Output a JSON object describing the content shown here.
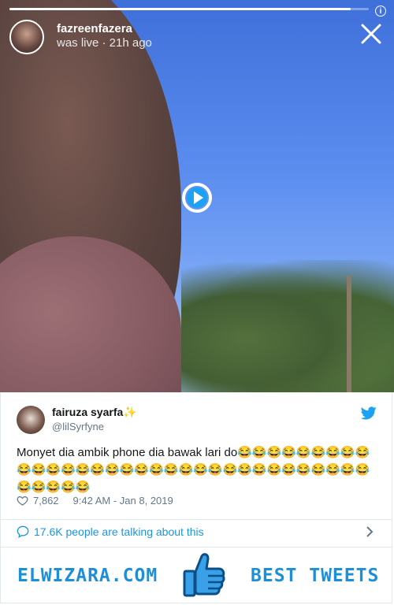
{
  "story": {
    "username": "fazreenfazera",
    "status": "was live · 21h ago",
    "progress": 0.95
  },
  "tweet": {
    "display_name": "fairuza syarfa✨",
    "handle": "@lilSyrfyne",
    "text": "Monyet dia ambik phone dia bawak lari do😂😂😂😂😂😂😂😂😂😂😂😂😂😂😂😂😂😂😂😂😂😂😂😂😂😂😂😂😂😂😂😂😂😂😂😂😂😂",
    "likes": "7,862",
    "timestamp": "9:42 AM - Jan 8, 2019",
    "talking": "17.6K people are talking about this"
  },
  "footer": {
    "left_text": "ELWIZARA.COM",
    "right_text": "BEST TWEETS"
  },
  "colors": {
    "twitter_blue": "#1da1f2",
    "link_blue": "#1b95e0",
    "footer_blue": "#1d8ed8"
  },
  "icons": [
    "info-icon",
    "close-icon",
    "play-icon",
    "twitter-bird-icon",
    "heart-icon",
    "speech-bubble-icon",
    "chevron-right-icon",
    "thumbs-up-icon"
  ]
}
